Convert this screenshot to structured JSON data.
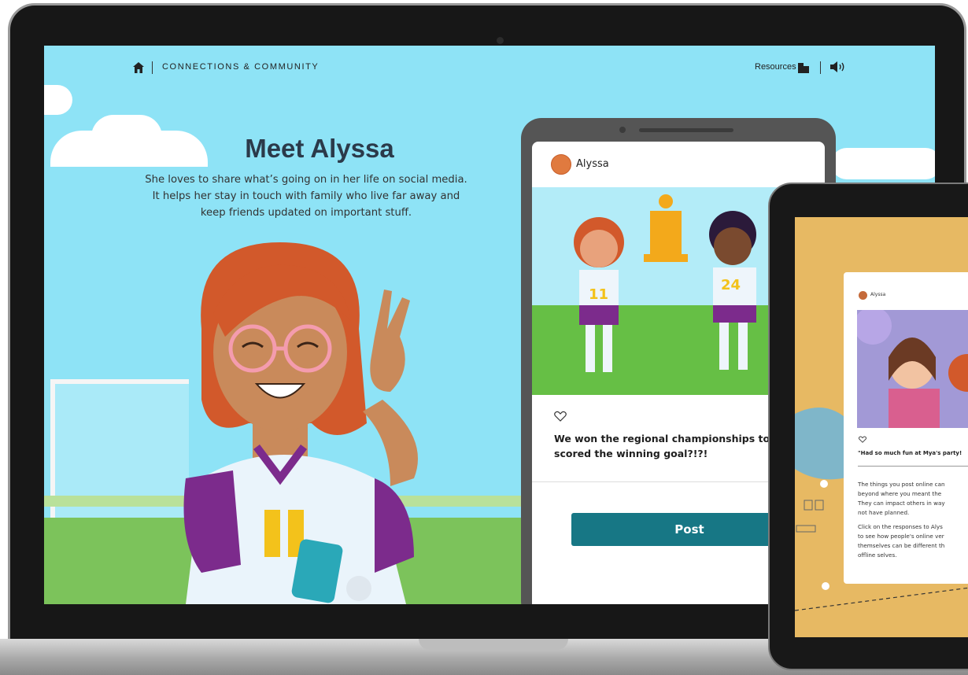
{
  "header": {
    "breadcrumb": "CONNECTIONS & COMMUNITY",
    "resources_label": "Resources"
  },
  "intro": {
    "title": "Meet Alyssa",
    "subtitle": "She loves to share what’s going on in her life on social media. It helps her stay in touch with family who live far away and keep friends updated on important stuff."
  },
  "phone_post": {
    "author": "Alyssa",
    "caption": "We won the regional championships today! who scored the winning goal?!?!",
    "post_button": "Post",
    "jersey_numbers": [
      "11",
      "24"
    ]
  },
  "tablet_post": {
    "author": "Alyssa",
    "caption": "\"Had so much fun at Mya's party!",
    "paragraphs": [
      [
        "The things you post online can",
        "beyond where you meant the",
        "They can impact others in way",
        "not have planned."
      ],
      [
        "Click on the responses to Alys",
        "to see how people's online ver",
        "themselves can be different th",
        "offline selves."
      ]
    ]
  },
  "colors": {
    "sky": "#8ee3f6",
    "accent_button": "#177785",
    "grass": "#7cc35b",
    "tablet_bg": "#e7b963"
  },
  "icons": [
    "home-icon",
    "resources-icon",
    "sound-icon",
    "heart-icon"
  ]
}
